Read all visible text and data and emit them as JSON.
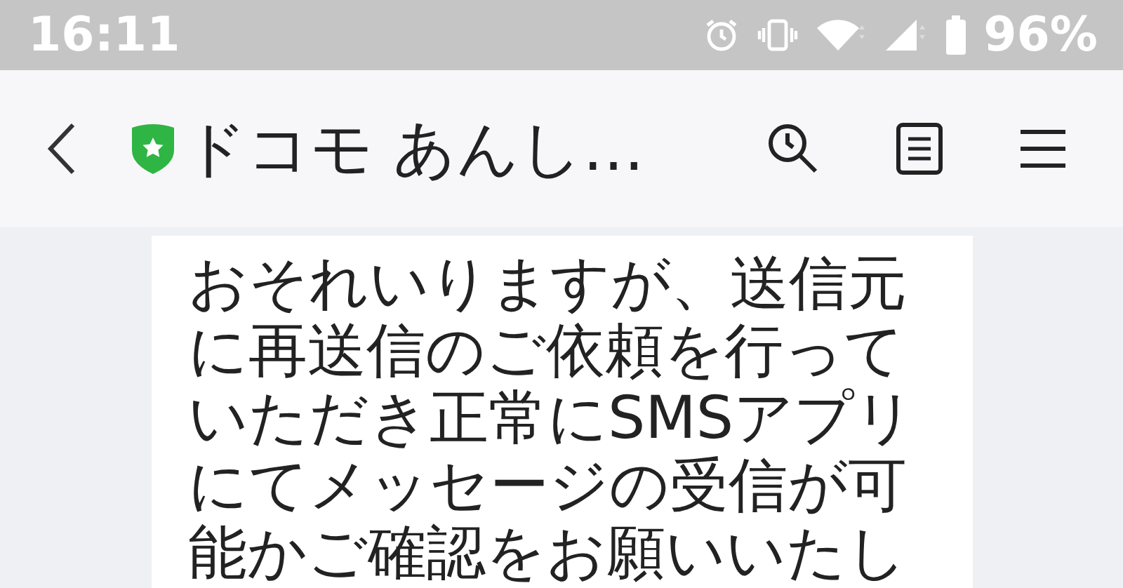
{
  "status_bar": {
    "time": "16:11",
    "battery": "96%"
  },
  "header": {
    "title": "ドコモ あんし…"
  },
  "message": {
    "lines": [
      "おそれいりますが、送信元",
      "に再送信のご依頼を行って",
      "いただき正常にSMSアプリ",
      "にてメッセージの受信が可",
      "能かご確認をお願いいたし"
    ]
  }
}
